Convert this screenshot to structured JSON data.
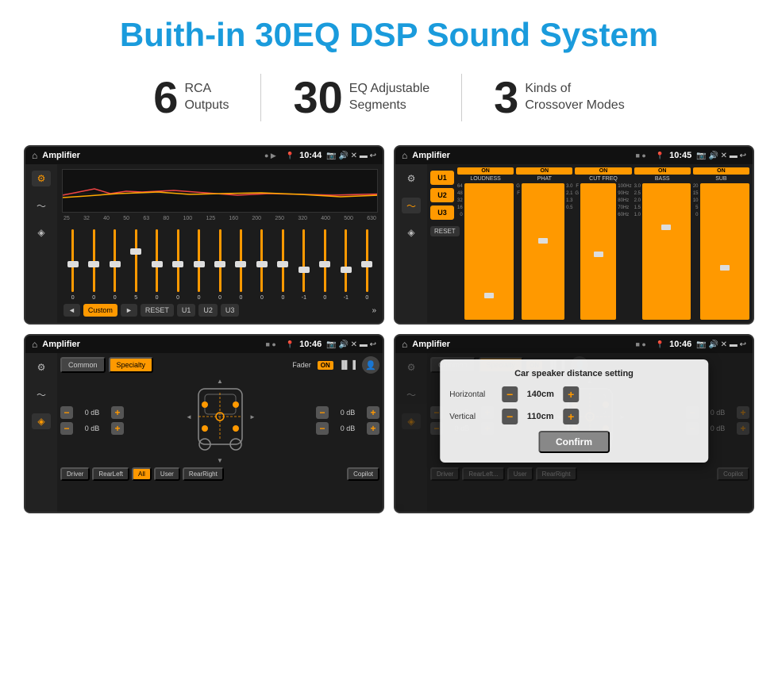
{
  "title": "Buith-in 30EQ DSP Sound System",
  "stats": [
    {
      "number": "6",
      "text_line1": "RCA",
      "text_line2": "Outputs"
    },
    {
      "number": "30",
      "text_line1": "EQ Adjustable",
      "text_line2": "Segments"
    },
    {
      "number": "3",
      "text_line1": "Kinds of",
      "text_line2": "Crossover Modes"
    }
  ],
  "screens": [
    {
      "id": "screen1",
      "title": "Amplifier",
      "time": "10:44",
      "type": "eq"
    },
    {
      "id": "screen2",
      "title": "Amplifier",
      "time": "10:45",
      "type": "crossover"
    },
    {
      "id": "screen3",
      "title": "Amplifier",
      "time": "10:46",
      "type": "fader"
    },
    {
      "id": "screen4",
      "title": "Amplifier",
      "time": "10:46",
      "type": "distance"
    }
  ],
  "eq": {
    "frequencies": [
      "25",
      "32",
      "40",
      "50",
      "63",
      "80",
      "100",
      "125",
      "160",
      "200",
      "250",
      "320",
      "400",
      "500",
      "630"
    ],
    "values": [
      "0",
      "0",
      "0",
      "5",
      "0",
      "0",
      "0",
      "0",
      "0",
      "0",
      "0",
      "-1",
      "0",
      "-1",
      "0"
    ],
    "presets": [
      "◄",
      "Custom",
      "►",
      "RESET",
      "U1",
      "U2",
      "U3"
    ]
  },
  "crossover": {
    "presets": [
      "U1",
      "U2",
      "U3"
    ],
    "bands": [
      {
        "on": true,
        "label": "LOUDNESS"
      },
      {
        "on": true,
        "label": "PHAT"
      },
      {
        "on": true,
        "label": "CUT FREQ"
      },
      {
        "on": true,
        "label": "BASS"
      },
      {
        "on": true,
        "label": "SUB"
      }
    ],
    "reset_label": "RESET"
  },
  "fader": {
    "tabs": [
      "Common",
      "Specialty"
    ],
    "fader_label": "Fader",
    "on_label": "ON",
    "db_rows": [
      {
        "value": "0 dB"
      },
      {
        "value": "0 dB"
      },
      {
        "value": "0 dB"
      },
      {
        "value": "0 dB"
      }
    ],
    "bottom_btns": [
      "Driver",
      "RearLeft",
      "All",
      "User",
      "RearRight",
      "Copilot"
    ],
    "all_active": true
  },
  "distance": {
    "title": "Car speaker distance setting",
    "horizontal_label": "Horizontal",
    "horizontal_value": "140cm",
    "vertical_label": "Vertical",
    "vertical_value": "110cm",
    "confirm_label": "Confirm"
  }
}
